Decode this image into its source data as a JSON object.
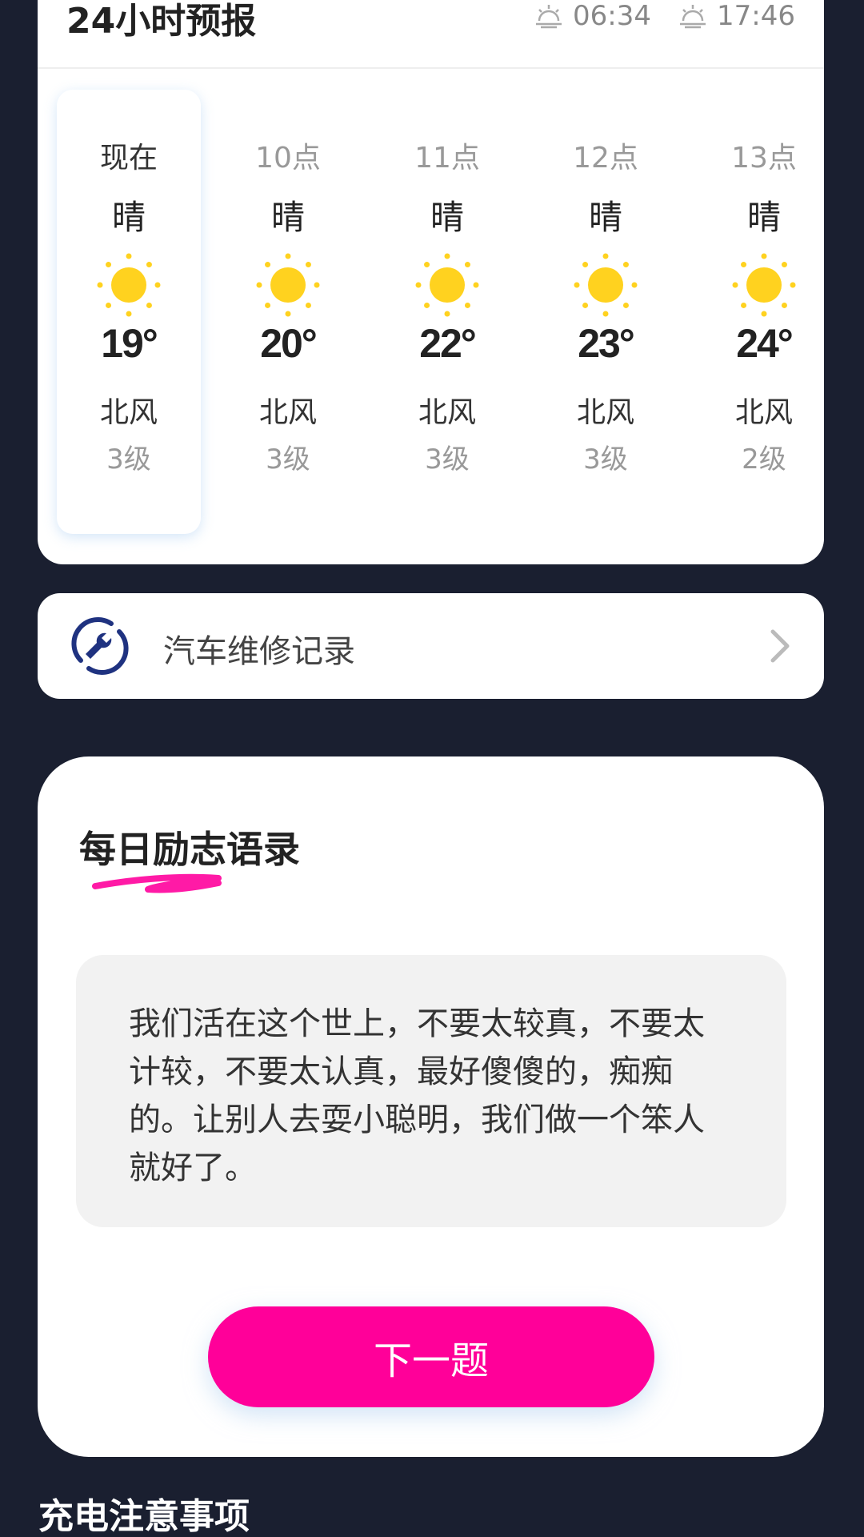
{
  "forecast": {
    "title": "24小时预报",
    "sunrise": "06:34",
    "sunset": "17:46",
    "hours": [
      {
        "time": "现在",
        "condition": "晴",
        "icon": "sun-icon",
        "temp": "19°",
        "wind": "北风",
        "level": "3级"
      },
      {
        "time": "10点",
        "condition": "晴",
        "icon": "sun-icon",
        "temp": "20°",
        "wind": "北风",
        "level": "3级"
      },
      {
        "time": "11点",
        "condition": "晴",
        "icon": "sun-icon",
        "temp": "22°",
        "wind": "北风",
        "level": "3级"
      },
      {
        "time": "12点",
        "condition": "晴",
        "icon": "sun-icon",
        "temp": "23°",
        "wind": "北风",
        "level": "3级"
      },
      {
        "time": "13点",
        "condition": "晴",
        "icon": "sun-icon",
        "temp": "24°",
        "wind": "北风",
        "level": "2级"
      }
    ]
  },
  "repair": {
    "label": "汽车维修记录",
    "icon": "wrench-icon"
  },
  "quote": {
    "title": "每日励志语录",
    "text": "我们活在这个世上，不要太较真，不要太计较，不要太认真，最好傻傻的，痴痴的。让别人去耍小聪明，我们做一个笨人就好了。",
    "next_label": "下一题"
  },
  "charging": {
    "title": "充电注意事项"
  },
  "colors": {
    "background": "#1a1f30",
    "accent": "#ff0099",
    "sun": "#ffd21f"
  }
}
